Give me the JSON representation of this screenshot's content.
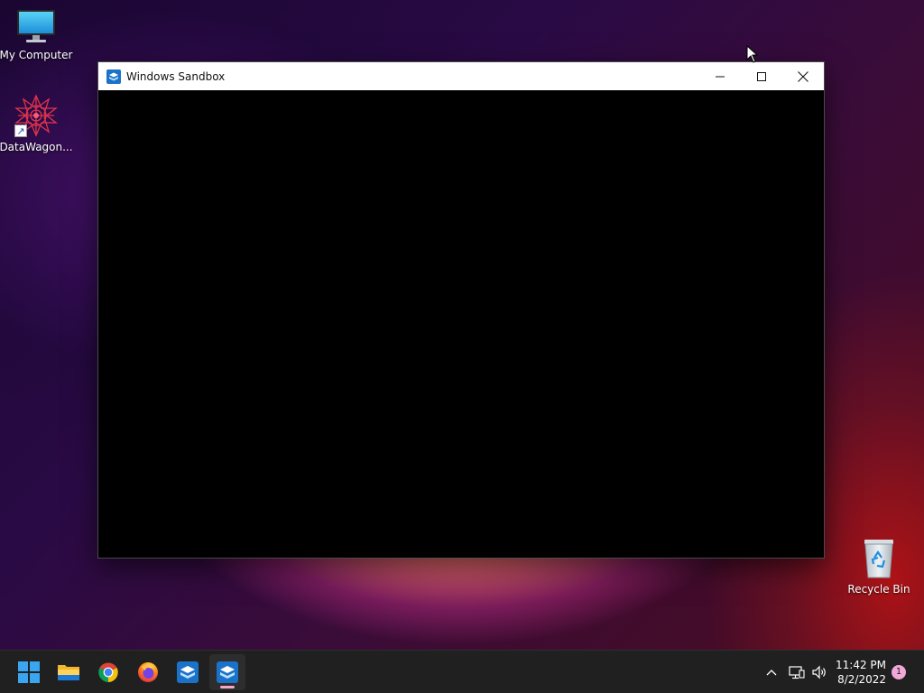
{
  "desktop": {
    "icons": [
      {
        "label": "My Computer"
      },
      {
        "label": "DataWagon..."
      },
      {
        "label": "Recycle Bin"
      }
    ]
  },
  "window": {
    "title": "Windows Sandbox",
    "content_color": "#000000"
  },
  "taskbar": {
    "apps": [
      {
        "name": "start-icon"
      },
      {
        "name": "file-explorer-icon"
      },
      {
        "name": "chrome-icon"
      },
      {
        "name": "firefox-icon"
      },
      {
        "name": "windows-sandbox-icon"
      },
      {
        "name": "windows-sandbox-icon",
        "active": true
      }
    ],
    "tray": {
      "time": "11:42 PM",
      "date": "8/2/2022",
      "notifications": "1"
    },
    "accent_indicator": "#f5a6c8"
  }
}
